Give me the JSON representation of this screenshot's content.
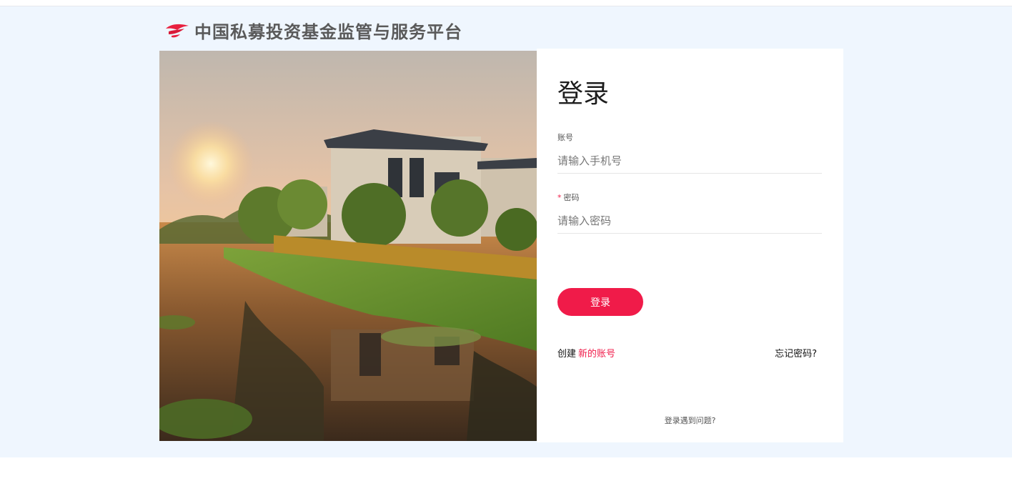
{
  "header": {
    "platform_title": "中国私募投资基金监管与服务平台",
    "logo_icon": "red-bird-logo"
  },
  "login": {
    "title": "登录",
    "account_label": "账号",
    "account_placeholder": "请输入手机号",
    "password_required_mark": "*",
    "password_label": "密码",
    "password_placeholder": "请输入密码",
    "submit_label": "登录",
    "create_prefix": "创建",
    "create_link": "新的账号",
    "forgot_link": "忘记密码?",
    "help_link": "登录遇到问题?"
  },
  "colors": {
    "accent": "#f01b49",
    "band_background": "#eff6fe"
  }
}
